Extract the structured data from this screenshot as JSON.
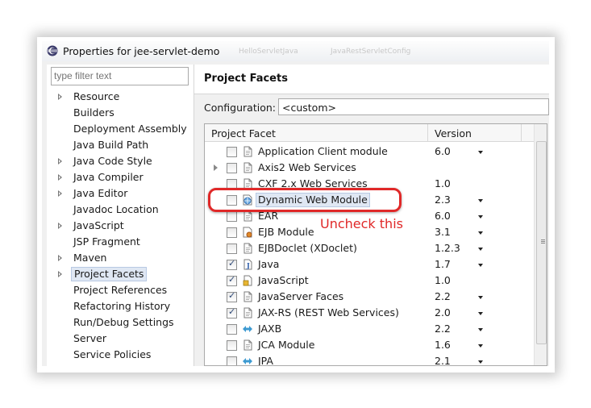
{
  "window": {
    "title": "Properties for jee-servlet-demo",
    "ghost_tabs": [
      "HelloServletJava",
      "JavaRestServletConfig"
    ]
  },
  "sidebar": {
    "filter_placeholder": "type filter text",
    "items": [
      {
        "label": "Resource",
        "expandable": true
      },
      {
        "label": "Builders",
        "expandable": false
      },
      {
        "label": "Deployment Assembly",
        "expandable": false
      },
      {
        "label": "Java Build Path",
        "expandable": false
      },
      {
        "label": "Java Code Style",
        "expandable": true
      },
      {
        "label": "Java Compiler",
        "expandable": true
      },
      {
        "label": "Java Editor",
        "expandable": true
      },
      {
        "label": "Javadoc Location",
        "expandable": false
      },
      {
        "label": "JavaScript",
        "expandable": true
      },
      {
        "label": "JSP Fragment",
        "expandable": false
      },
      {
        "label": "Maven",
        "expandable": true
      },
      {
        "label": "Project Facets",
        "expandable": true,
        "selected": true
      },
      {
        "label": "Project References",
        "expandable": false
      },
      {
        "label": "Refactoring History",
        "expandable": false
      },
      {
        "label": "Run/Debug Settings",
        "expandable": false
      },
      {
        "label": "Server",
        "expandable": false
      },
      {
        "label": "Service Policies",
        "expandable": false
      }
    ]
  },
  "main": {
    "title": "Project Facets",
    "configuration_label": "Configuration:",
    "configuration_value": "<custom>",
    "columns": {
      "facet": "Project Facet",
      "version": "Version"
    },
    "facets": [
      {
        "name": "Application Client module",
        "version": "6.0",
        "checked": false,
        "dropdown": true,
        "expandable": false,
        "icon": "page-icon"
      },
      {
        "name": "Axis2 Web Services",
        "version": "",
        "checked": false,
        "dropdown": false,
        "expandable": true,
        "icon": "page-icon"
      },
      {
        "name": "CXF 2.x Web Services",
        "version": "1.0",
        "checked": false,
        "dropdown": false,
        "expandable": false,
        "icon": "page-icon"
      },
      {
        "name": "Dynamic Web Module",
        "version": "2.3",
        "checked": false,
        "dropdown": true,
        "expandable": false,
        "icon": "web-module-icon",
        "selected": true
      },
      {
        "name": "EAR",
        "version": "6.0",
        "checked": false,
        "dropdown": true,
        "expandable": false,
        "icon": "page-icon"
      },
      {
        "name": "EJB Module",
        "version": "3.1",
        "checked": false,
        "dropdown": true,
        "expandable": false,
        "icon": "ejb-icon"
      },
      {
        "name": "EJBDoclet (XDoclet)",
        "version": "1.2.3",
        "checked": false,
        "dropdown": true,
        "expandable": false,
        "icon": "page-icon"
      },
      {
        "name": "Java",
        "version": "1.7",
        "checked": true,
        "dropdown": true,
        "expandable": false,
        "icon": "java-icon"
      },
      {
        "name": "JavaScript",
        "version": "1.0",
        "checked": true,
        "dropdown": false,
        "expandable": false,
        "icon": "javascript-icon"
      },
      {
        "name": "JavaServer Faces",
        "version": "2.2",
        "checked": true,
        "dropdown": true,
        "expandable": false,
        "icon": "page-icon"
      },
      {
        "name": "JAX-RS (REST Web Services)",
        "version": "2.0",
        "checked": true,
        "dropdown": true,
        "expandable": false,
        "icon": "page-icon"
      },
      {
        "name": "JAXB",
        "version": "2.2",
        "checked": false,
        "dropdown": true,
        "expandable": false,
        "icon": "jaxb-icon"
      },
      {
        "name": "JCA Module",
        "version": "1.6",
        "checked": false,
        "dropdown": true,
        "expandable": false,
        "icon": "page-icon"
      },
      {
        "name": "JPA",
        "version": "2.1",
        "checked": false,
        "dropdown": true,
        "expandable": false,
        "icon": "jpa-icon"
      }
    ]
  },
  "annotation": {
    "text": "Uncheck this",
    "color": "#e02828"
  }
}
